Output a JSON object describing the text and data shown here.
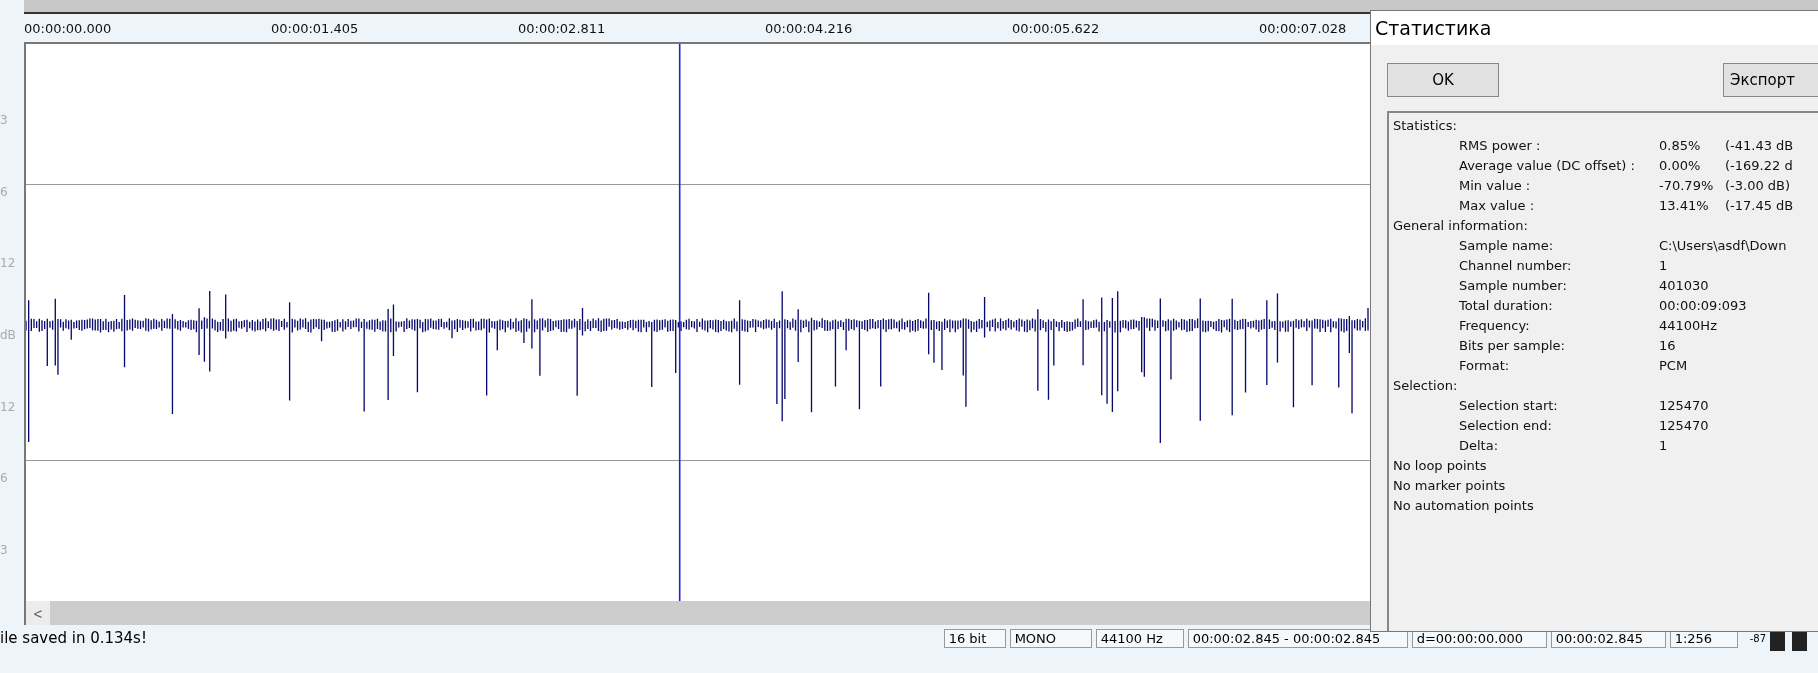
{
  "timeline": {
    "ticks": [
      "00:00:00.000",
      "00:00:01.405",
      "00:00:02.811",
      "00:00:04.216",
      "00:00:05.622",
      "00:00:07.028"
    ]
  },
  "db_axis": {
    "labels": [
      "3",
      "6",
      "12",
      "dB",
      "12",
      "6",
      "3"
    ]
  },
  "scrollbar": {
    "left_arrow": "<"
  },
  "status_bar": {
    "message": "ile saved in 0.134s!",
    "fields": [
      "16 bit",
      "MONO",
      "44100 Hz",
      "00:00:02.845 - 00:00:02.845",
      "d=00:00:00.000",
      "00:00:02.845",
      "1:256"
    ],
    "meter_reading": "-87"
  },
  "dialog": {
    "title": "Статистика",
    "buttons": [
      {
        "label": "OK",
        "kind": "ok"
      },
      {
        "label": "Экспорт",
        "kind": "export"
      }
    ],
    "sections": [
      {
        "title": "Statistics:",
        "rows": [
          {
            "label": "RMS power :",
            "value": "0.85%",
            "db": "(-41.43 dB"
          },
          {
            "label": "Average value (DC offset) :",
            "value": "0.00%",
            "db": "(-169.22 d"
          },
          {
            "label": "Min value :",
            "value": "-70.79%",
            "db": "(-3.00 dB)"
          },
          {
            "label": "Max value :",
            "value": "13.41%",
            "db": "(-17.45 dB"
          }
        ]
      },
      {
        "title": "General information:",
        "rows": [
          {
            "label": "Sample name:",
            "value": "C:\\Users\\asdf\\Down"
          },
          {
            "label": "Channel number:",
            "value": "1"
          },
          {
            "label": "Sample number:",
            "value": "401030"
          },
          {
            "label": "Total duration:",
            "value": "00:00:09:093"
          },
          {
            "label": "Frequency:",
            "value": "44100Hz"
          },
          {
            "label": "Bits per sample:",
            "value": "16"
          },
          {
            "label": "Format:",
            "value": "PCM"
          }
        ]
      },
      {
        "title": "Selection:",
        "rows": [
          {
            "label": "Selection start:",
            "value": "125470"
          },
          {
            "label": "Selection end:",
            "value": "125470"
          },
          {
            "label": "Delta:",
            "value": "1"
          }
        ]
      }
    ],
    "notes": [
      "No loop points",
      "No marker points",
      "No automation points"
    ]
  }
}
